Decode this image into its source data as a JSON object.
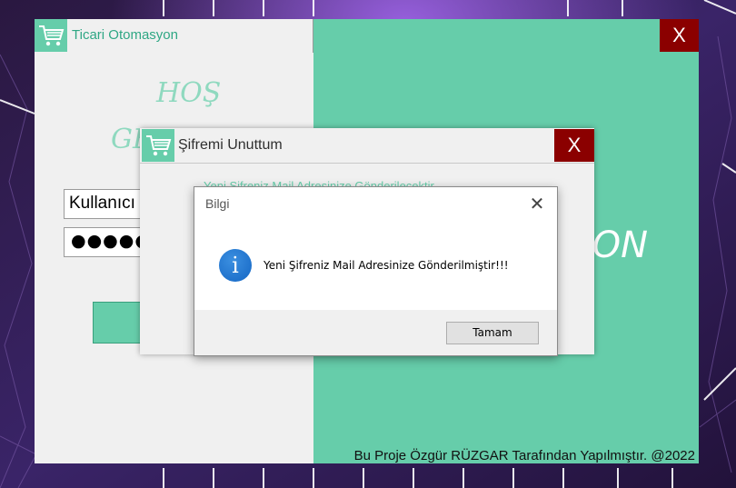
{
  "main_window": {
    "title": "Ticari Otomasyon",
    "close_label": "X",
    "welcome_line1": "HOŞ",
    "welcome_line2": "GE",
    "username_value": "Kullanıcı",
    "password_mask": "●●●●●",
    "right_text": "ON",
    "footer": "Bu Proje Özgür RÜZGAR Tarafından Yapılmıştır. @2022",
    "accent_color": "#66cdaa",
    "close_color": "#8b0000"
  },
  "forgot_window": {
    "title": "Şifremi Unuttum",
    "close_label": "X",
    "status_text": "Yeni Şifreniz Mail Adresinize Gönderilecektir"
  },
  "message_box": {
    "title": "Bilgi",
    "close_label": "✕",
    "icon": "info-icon",
    "icon_glyph": "i",
    "message": "Yeni Şifreniz Mail Adresinize Gönderilmiştir!!!",
    "ok_label": "Tamam"
  }
}
